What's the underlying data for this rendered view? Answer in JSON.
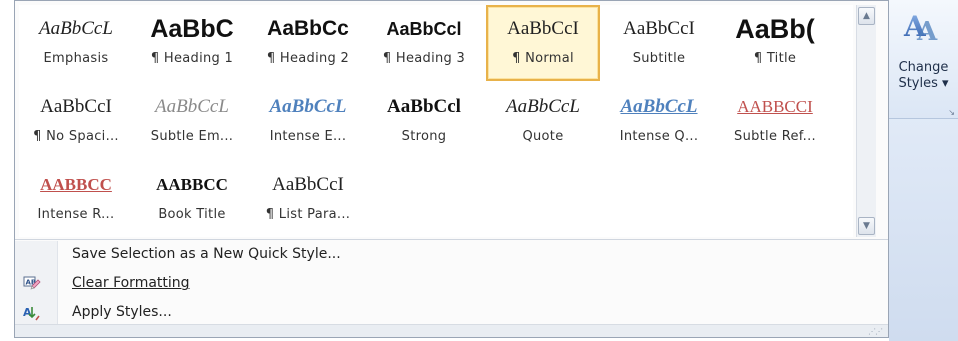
{
  "gallery": {
    "styles": [
      {
        "sample": "AaBbCcL",
        "label": "Emphasis"
      },
      {
        "sample": "AaBbC",
        "label": "¶ Heading 1"
      },
      {
        "sample": "AaBbCc",
        "label": "¶ Heading 2"
      },
      {
        "sample": "AaBbCcl",
        "label": "¶ Heading 3"
      },
      {
        "sample": "AaBbCcI",
        "label": "¶ Normal"
      },
      {
        "sample": "AaBbCcI",
        "label": "Subtitle"
      },
      {
        "sample": "AaBb(",
        "label": "¶ Title"
      },
      {
        "sample": "AaBbCcI",
        "label": "¶ No Spaci..."
      },
      {
        "sample": "AaBbCcL",
        "label": "Subtle Em..."
      },
      {
        "sample": "AaBbCcL",
        "label": "Intense E..."
      },
      {
        "sample": "AaBbCcl",
        "label": "Strong"
      },
      {
        "sample": "AaBbCcL",
        "label": "Quote"
      },
      {
        "sample": "AaBbCcL",
        "label": "Intense Q..."
      },
      {
        "sample": "AABBCCI",
        "label": "Subtle Ref..."
      },
      {
        "sample": "AABBCC",
        "label": "Intense R..."
      },
      {
        "sample": "AABBCC",
        "label": "Book Title"
      },
      {
        "sample": "AaBbCcI",
        "label": "¶ List Para..."
      }
    ],
    "selected_label": "¶ Normal"
  },
  "menu": {
    "save_selection": "Save Selection as a New Quick Style...",
    "clear_formatting": "Clear Formatting",
    "apply_styles": "Apply Styles..."
  },
  "ribbon": {
    "change_styles_line1": "Change",
    "change_styles_line2": "Styles ▾"
  },
  "colors": {
    "accent_selected": "#e8b24a",
    "heading_blue": "#1f4e79",
    "intense_blue": "#4f81bd",
    "reference_red": "#c0504d"
  }
}
